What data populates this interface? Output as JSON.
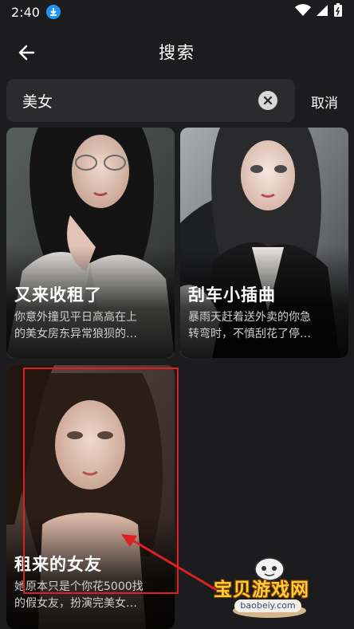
{
  "status_bar": {
    "time": "2:40"
  },
  "header": {
    "title": "搜索"
  },
  "search": {
    "query": "美女",
    "cancel_label": "取消"
  },
  "results": [
    {
      "title": "又来收租了",
      "desc_line1": "你意外撞见平日高高在上",
      "desc_line2": "的美女房东异常狼狈的…"
    },
    {
      "title": "刮车小插曲",
      "desc_line1": "暴雨天赶着送外卖的你急",
      "desc_line2": "转弯时，不慎刮花了停…"
    },
    {
      "title": "租来的女友",
      "desc_line1": "她原本只是个你花5000找",
      "desc_line2": "的假女友，扮演完美女…"
    }
  ],
  "watermark": {
    "text": "宝贝游戏网",
    "url": "baobeiy.com"
  },
  "colors": {
    "background": "#1c1c1e",
    "search_bg": "#2b2b2d",
    "highlight": "#e02020",
    "accent_blue": "#2196f3"
  }
}
